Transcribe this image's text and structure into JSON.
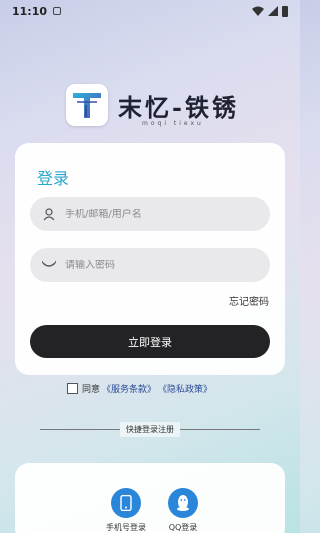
{
  "status_bar": {
    "time": "11:10"
  },
  "brand": {
    "title": "末忆-铁锈",
    "subtitle": "moqi tiexu"
  },
  "login": {
    "title": "登录",
    "username_placeholder": "手机/邮箱/用户名",
    "password_placeholder": "请输入密码",
    "forgot_label": "忘记密码",
    "submit_label": "立即登录"
  },
  "agreement": {
    "prefix": "同意",
    "terms_link": "《服务条款》",
    "privacy_link": "《隐私政策》"
  },
  "quick_login": {
    "divider_label": "快捷登录注册",
    "items": [
      {
        "label": "手机号登录",
        "icon": "phone-icon"
      },
      {
        "label": "QQ登录",
        "icon": "qq-icon"
      }
    ]
  },
  "colors": {
    "accent": "#29a6cf",
    "button": "#232325",
    "quick_icon": "#2a86d8",
    "link": "#2b4d9b"
  }
}
